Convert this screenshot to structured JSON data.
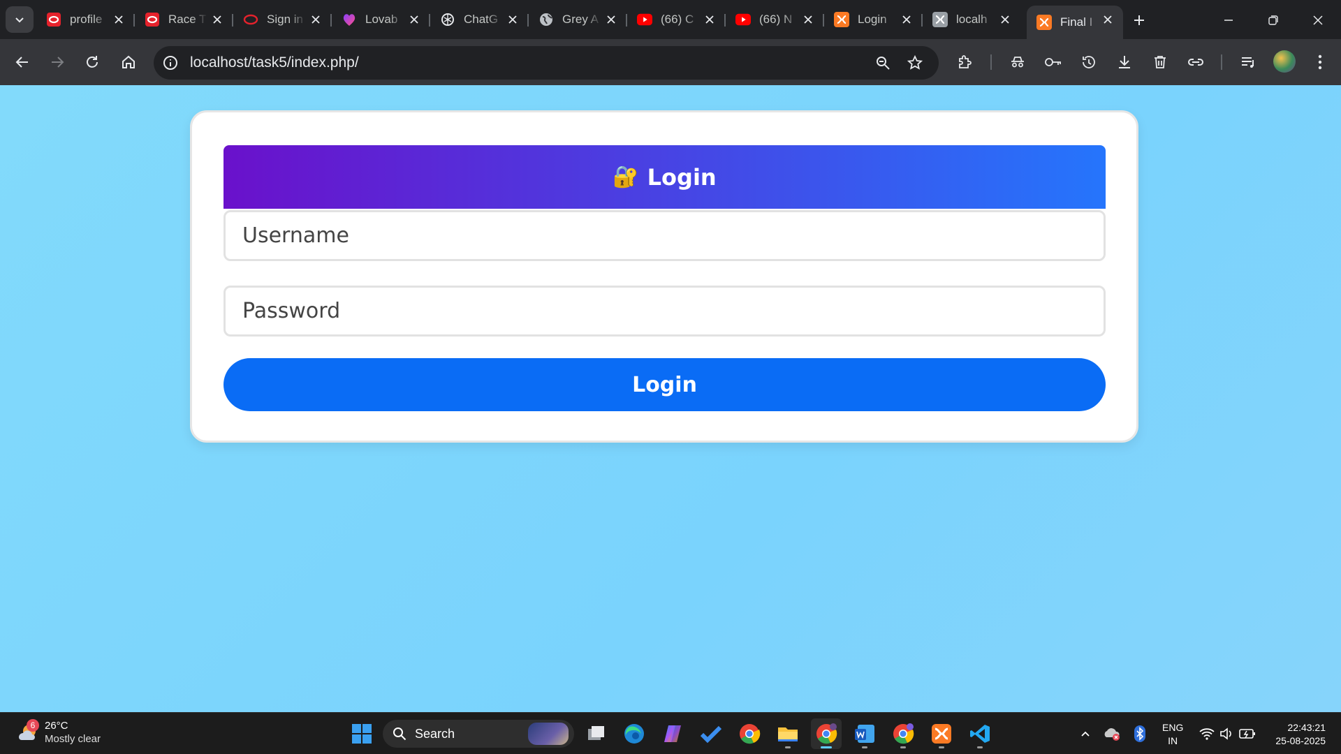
{
  "browser": {
    "tabs": [
      {
        "title": "profile",
        "icon": "opera-icon",
        "active": false
      },
      {
        "title": "Race T",
        "icon": "opera-icon",
        "active": false
      },
      {
        "title": "Sign in",
        "icon": "opera-icon",
        "active": false
      },
      {
        "title": "Lovab",
        "icon": "lovable-icon",
        "active": false
      },
      {
        "title": "ChatG",
        "icon": "chatgpt-icon",
        "active": false
      },
      {
        "title": "Grey A",
        "icon": "globe-icon",
        "active": false
      },
      {
        "title": "(66) C",
        "icon": "youtube-icon",
        "active": false
      },
      {
        "title": "(66) N",
        "icon": "youtube-icon",
        "active": false
      },
      {
        "title": "Login",
        "icon": "xampp-icon",
        "active": false
      },
      {
        "title": "localh",
        "icon": "xampp-icon",
        "active": false
      },
      {
        "title": "Final I",
        "icon": "xampp-icon",
        "active": true
      }
    ],
    "url": "localhost/task5/index.php/"
  },
  "login": {
    "header_icon": "🔐",
    "header_title": "Login",
    "username_placeholder": "Username",
    "password_placeholder": "Password",
    "button_label": "Login"
  },
  "taskbar": {
    "weather_temp": "26°C",
    "weather_desc": "Mostly clear",
    "weather_badge": "6",
    "search_label": "Search",
    "lang_top": "ENG",
    "lang_bottom": "IN",
    "time": "22:43:21",
    "date": "25-08-2025"
  },
  "colors": {
    "page_bg": "#7fd8fc",
    "header_gradient_start": "#6a11cb",
    "header_gradient_end": "#2575fc",
    "button_bg": "#0a6cf5"
  }
}
